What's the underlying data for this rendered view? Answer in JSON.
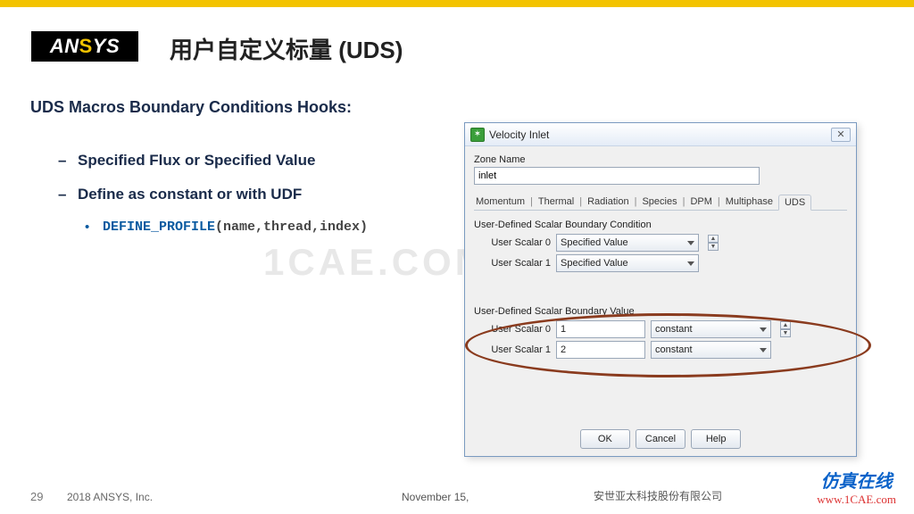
{
  "logo": "ANSYS",
  "slide_title": "用户自定义标量 (UDS)",
  "section_heading": "UDS Macros Boundary Conditions Hooks:",
  "bullets": {
    "b1": "Specified Flux or Specified Value",
    "b2": "Define as constant or with UDF",
    "sub_macro": "DEFINE_PROFILE",
    "sub_args": "(name,thread,index)"
  },
  "watermark_bg": "1CAE.COM",
  "dialog": {
    "title": "Velocity Inlet",
    "zone_label": "Zone Name",
    "zone_value": "inlet",
    "tabs": [
      "Momentum",
      "Thermal",
      "Radiation",
      "Species",
      "DPM",
      "Multiphase",
      "UDS"
    ],
    "selected_tab": "UDS",
    "group1_label": "User-Defined Scalar Boundary Condition",
    "bc_rows": [
      {
        "label": "User Scalar 0",
        "value": "Specified Value"
      },
      {
        "label": "User Scalar 1",
        "value": "Specified Value"
      }
    ],
    "group2_label": "User-Defined Scalar Boundary Value",
    "val_rows": [
      {
        "label": "User Scalar 0",
        "number": "1",
        "mode": "constant"
      },
      {
        "label": "User Scalar 1",
        "number": "2",
        "mode": "constant"
      }
    ],
    "buttons": {
      "ok": "OK",
      "cancel": "Cancel",
      "help": "Help"
    }
  },
  "footer": {
    "slide_number": "29",
    "copyright": "2018  ANSYS, Inc.",
    "date": "November 15,",
    "company": "安世亚太科技股份有限公司",
    "wm_cn": "仿真在线",
    "wm_url": "www.1CAE.com"
  }
}
